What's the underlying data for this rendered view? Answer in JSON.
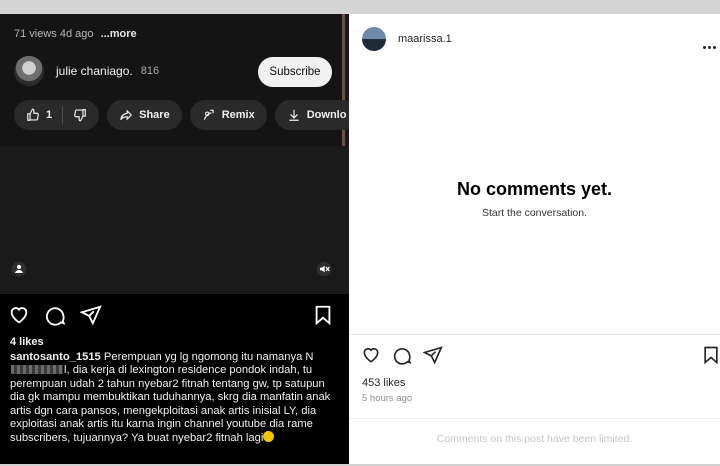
{
  "left_post": {
    "video": {
      "views_meta": "71 views  4d ago",
      "more_label": "...more",
      "channel_name": "julie chaniago.",
      "subscriber_count": "816",
      "subscribe_label": "Subscribe",
      "like_count": "1",
      "share_label": "Share",
      "remix_label": "Remix",
      "download_label": "Downlo"
    },
    "likes": "4 likes",
    "caption": {
      "username": "santosanto_1515",
      "text_before_redaction": " Perempuan yg lg ngomong itu namanya N",
      "text_after_redaction": "l, dia kerja di lexington residence pondok indah, tu perempuan udah 2 tahun nyebar2 fitnah tentang gw, tp satupun dia gk mampu membuktikan tuduhannya, skrg dia manfatin anak artis dgn cara pansos, mengekploitasi anak artis inisial LY, dia exploitasi anak artis itu karna ingin channel youtube dia rame subscribers, tujuannya? Ya buat nyebar2 fitnah lagi"
    }
  },
  "right_post": {
    "username": "maarissa.1",
    "empty_title": "No comments yet.",
    "empty_subtitle": "Start the conversation.",
    "likes": "453 likes",
    "time": "5 hours ago",
    "comments_limited": "Comments on this post have been limited."
  },
  "colors": {
    "left_bg": "#000000",
    "video_bg": "#1a1a1a",
    "right_bg": "#ffffff",
    "subscribe_bg": "#f1f1f1"
  }
}
